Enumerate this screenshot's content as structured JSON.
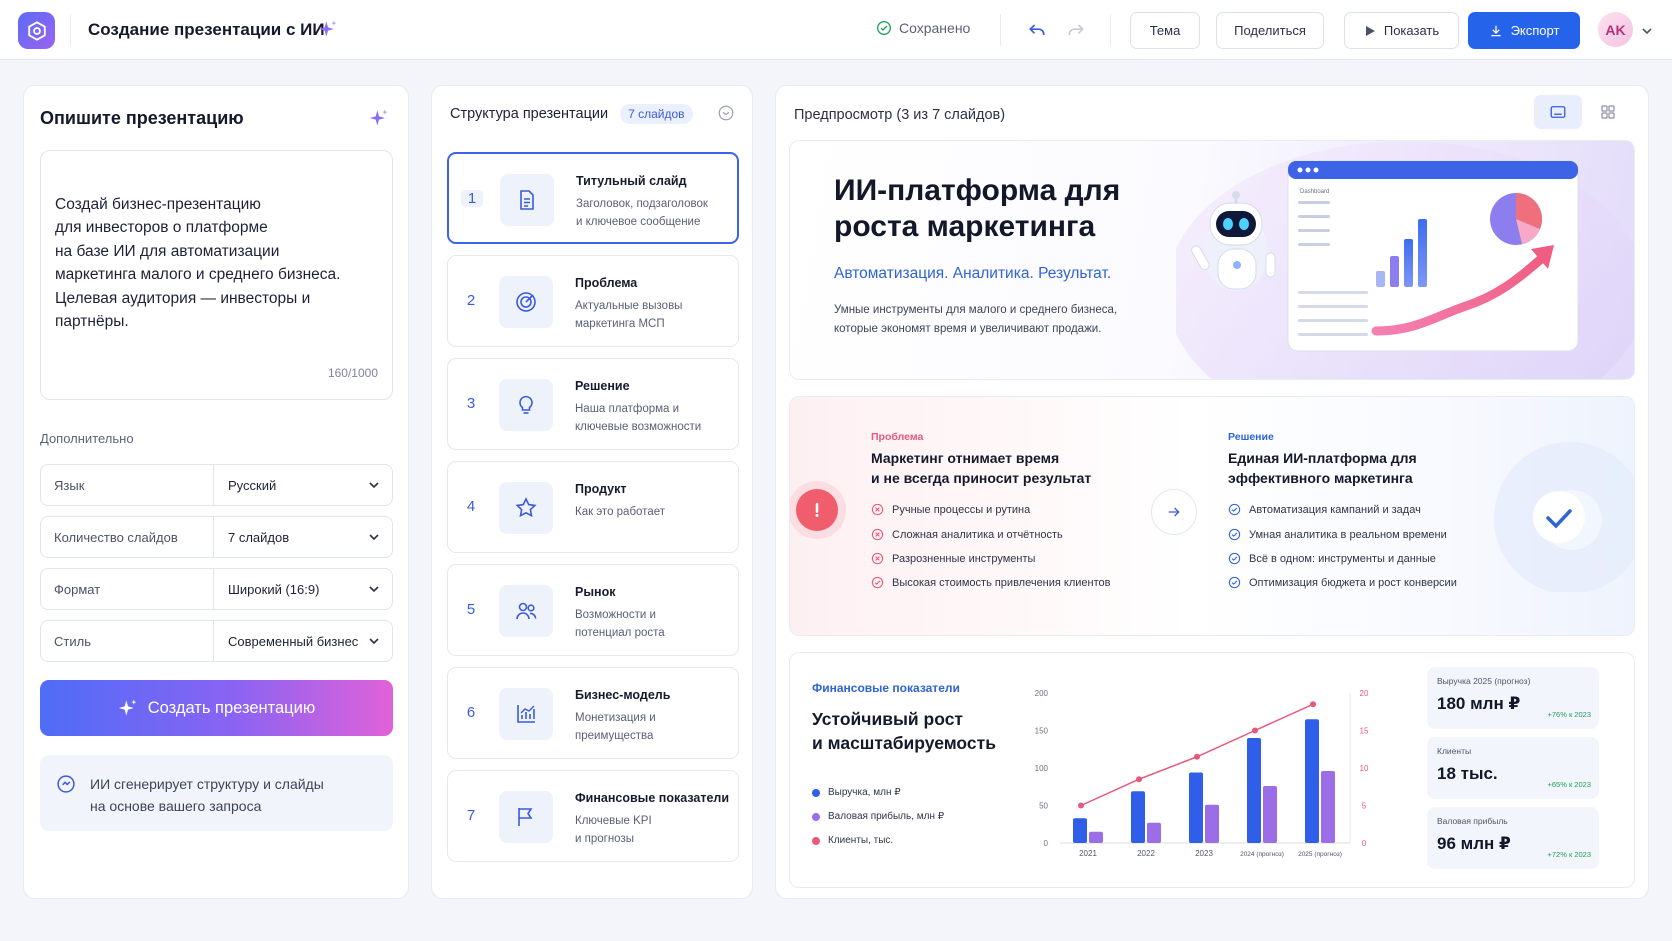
{
  "header": {
    "title": "Создание презентации с ИИ",
    "saved": "Сохранено",
    "theme": "Тема",
    "share": "Поделиться",
    "show": "Показать",
    "export": "Экспорт",
    "avatar": "AK"
  },
  "left": {
    "heading": "Опишите презентацию",
    "prompt": "Создай бизнес-презентацию\nдля инвесторов о платформе\nна базе ИИ для автоматизации\nмаркетинга малого и среднего бизнеса.\nЦелевая аудитория — инвесторы и\nпартнёры.",
    "counter": "160/1000",
    "section": "Дополнительно",
    "options": [
      {
        "key": "Язык",
        "value": "Русский"
      },
      {
        "key": "Количество слайдов",
        "value": "7 слайдов"
      },
      {
        "key": "Формат",
        "value": "Широкий (16:9)"
      },
      {
        "key": "Стиль",
        "value": "Современный бизнес"
      }
    ],
    "create": "Создать презентацию",
    "hint": "ИИ сгенерирует структуру и слайды\nна основе вашего запроса"
  },
  "structure": {
    "heading": "Структура презентации",
    "badge": "7 слайдов",
    "slides": [
      {
        "num": "1",
        "title": "Титульный слайд",
        "desc": "Заголовок, подзаголовок\nи ключевое сообщение",
        "icon": "document-icon"
      },
      {
        "num": "2",
        "title": "Проблема",
        "desc": "Актуальные вызовы\nмаркетинга МСП",
        "icon": "target-icon"
      },
      {
        "num": "3",
        "title": "Решение",
        "desc": "Наша платформа и\nключевые возможности",
        "icon": "lightbulb-icon"
      },
      {
        "num": "4",
        "title": "Продукт",
        "desc": "Как это работает",
        "icon": "star-icon"
      },
      {
        "num": "5",
        "title": "Рынок",
        "desc": "Возможности и\nпотенциал роста",
        "icon": "users-icon"
      },
      {
        "num": "6",
        "title": "Бизнес-модель",
        "desc": "Монетизация и\nпреимущества",
        "icon": "chart-icon"
      },
      {
        "num": "7",
        "title": "Финансовые показатели",
        "desc": "Ключевые KPI\nи прогнозы",
        "icon": "flag-icon"
      }
    ]
  },
  "preview": {
    "heading": "Предпросмотр (3 из 7 слайдов)",
    "hero": {
      "title": "ИИ-платформа для роста маркетинга",
      "subtitle": "Автоматизация. Аналитика. Результат.",
      "desc": "Умные инструменты для малого и среднего бизнеса,\nкоторые экономят время и увеличивают продажи.",
      "mock_label": "Dashboard"
    },
    "problem": {
      "label": "Проблема",
      "title": "Маркетинг отнимает время\nи не всегда приносит результат",
      "items": [
        "Ручные процессы и рутина",
        "Сложная аналитика и отчётность",
        "Разрозненные инструменты",
        "Высокая стоимость привлечения клиентов"
      ]
    },
    "solution": {
      "label": "Решение",
      "title": "Единая ИИ-платформа для\nэффективного маркетинга",
      "items": [
        "Автоматизация кампаний и задач",
        "Умная аналитика в реальном времени",
        "Всё в одном: инструменты и данные",
        "Оптимизация бюджета и рост конверсии"
      ]
    },
    "finance": {
      "label": "Финансовые показатели",
      "title": "Устойчивый рост\nи масштабируемость",
      "kpis": [
        {
          "label": "Выручка 2025 (прогноз)",
          "value": "180 млн ₽",
          "delta": "+76% к 2023"
        },
        {
          "label": "Клиенты",
          "value": "18 тыс.",
          "delta": "+65% к 2023"
        },
        {
          "label": "Валовая прибыль",
          "value": "96 млн ₽",
          "delta": "+72% к 2023"
        }
      ]
    }
  },
  "chart_data": {
    "type": "bar",
    "categories": [
      "2021",
      "2022",
      "2023",
      "2024 (прогноз)",
      "2025 (прогноз)"
    ],
    "series": [
      {
        "name": "Выручка, млн ₽",
        "type": "bar",
        "axis": "left",
        "color": "#2f5ee8",
        "values": [
          33,
          69,
          94,
          140,
          165
        ]
      },
      {
        "name": "Валовая прибыль, млн ₽",
        "type": "bar",
        "axis": "left",
        "color": "#9b6ee8",
        "values": [
          15,
          27,
          51,
          76,
          96
        ]
      },
      {
        "name": "Клиенты, тыс.",
        "type": "line",
        "axis": "right",
        "color": "#e8587a",
        "values": [
          5,
          8.5,
          11.5,
          15,
          18.5
        ]
      }
    ],
    "ylim": [
      0,
      200
    ],
    "yticks": [
      "0",
      "50",
      "100",
      "150",
      "200"
    ],
    "y2lim": [
      0,
      20
    ],
    "y2ticks": [
      "0",
      "5",
      "10",
      "15",
      "20"
    ],
    "grid": false,
    "legend": "left"
  },
  "colors": {
    "accent": "#2563eb",
    "brand": "#6b63f0",
    "problem": "#e8587a",
    "solution": "#2f63d6"
  }
}
